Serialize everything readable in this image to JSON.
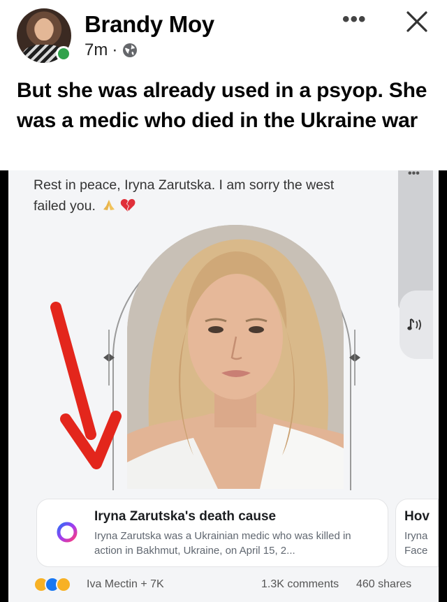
{
  "post": {
    "author": "Brandy Moy",
    "time": "7m",
    "separator": "·",
    "caption": "But she was already used in a psyop. She was a medic who died in the Ukraine war"
  },
  "icons": {
    "privacy": "globe-icon",
    "more": "more-icon",
    "close": "close-icon",
    "online_status": "online-dot",
    "music": "music-note-icon",
    "link": "circle-logo-icon",
    "arrow": "red-arrow"
  },
  "colors": {
    "online": "#31a24c",
    "arrow": "#e3261c",
    "heart": "#e0303a"
  },
  "screenshot": {
    "text_line1": "Rest in peace, Iryna Zarutska. I am sorry the west",
    "text_line2": "failed you.",
    "link_card": {
      "title": "Iryna Zarutska's death cause",
      "description": "Iryna Zarutska was a Ukrainian medic who was killed in action in Bakhmut, Ukraine, on April 15, 2..."
    },
    "side_card": {
      "title": "Hov",
      "description_line1": "Iryna",
      "description_line2": "Face"
    },
    "reactions": {
      "reactors": "Iva Mectin + 7K",
      "comments": "1.3K comments",
      "shares": "460 shares"
    }
  }
}
